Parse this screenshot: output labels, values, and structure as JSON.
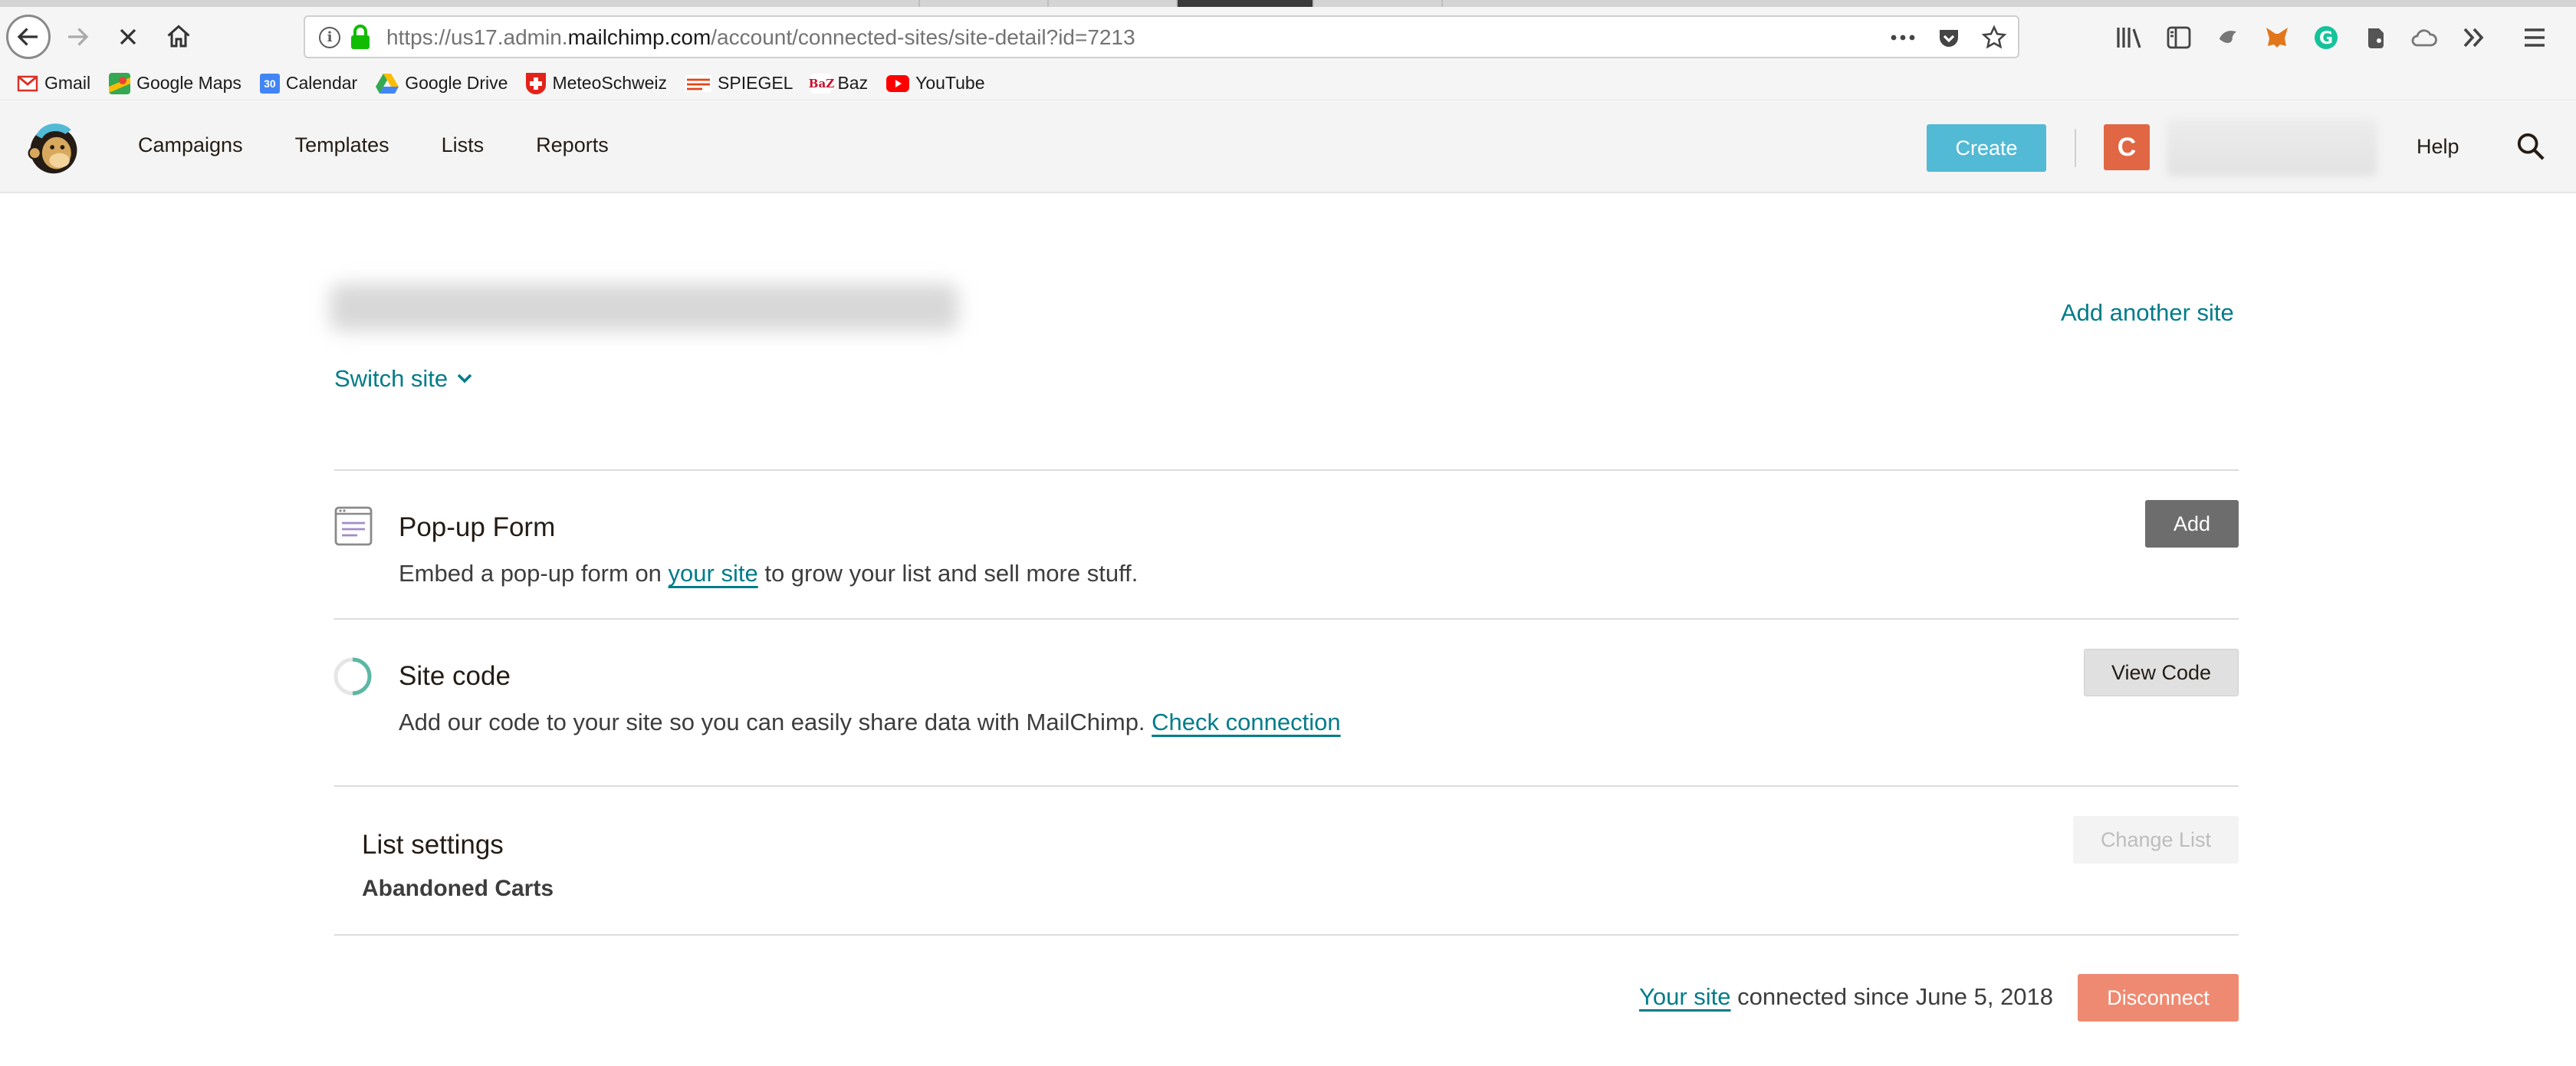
{
  "browser": {
    "url_prefix": "https://us17.admin.",
    "url_domain": "mailchimp.com",
    "url_path": "/account/connected-sites/site-detail?id=7213",
    "bookmarks": [
      {
        "label": "Gmail",
        "icon": "gmail-icon",
        "color": "#d93025"
      },
      {
        "label": "Google Maps",
        "icon": "maps-icon",
        "color": "#34a853"
      },
      {
        "label": "Calendar",
        "icon": "calendar-icon",
        "color": "#4285f4",
        "glyph": "30"
      },
      {
        "label": "Google Drive",
        "icon": "drive-icon",
        "color": "#fbbc04"
      },
      {
        "label": "MeteoSchweiz",
        "icon": "swiss-flag-icon",
        "color": "#e2231a"
      },
      {
        "label": "SPIEGEL",
        "icon": "spiegel-icon",
        "color": "#e64415"
      },
      {
        "label": "Baz",
        "icon": "baz-icon",
        "color": "#c8102e",
        "glyph": "BaZ"
      },
      {
        "label": "YouTube",
        "icon": "youtube-icon",
        "color": "#ff0000"
      }
    ]
  },
  "header": {
    "nav": [
      "Campaigns",
      "Templates",
      "Lists",
      "Reports"
    ],
    "create_label": "Create",
    "avatar_initial": "C",
    "help_label": "Help"
  },
  "site": {
    "add_another_label": "Add another site",
    "switch_label": "Switch site"
  },
  "popup_form": {
    "title": "Pop-up Form",
    "desc_before": "Embed a pop-up form on ",
    "desc_link": "your site",
    "desc_after": " to grow your list and sell more stuff.",
    "button": "Add"
  },
  "site_code": {
    "title": "Site code",
    "desc_before": "Add our code to your site so you can easily share data with MailChimp. ",
    "desc_link": "Check connection",
    "button": "View Code"
  },
  "list_settings": {
    "title": "List settings",
    "list_name": "Abandoned Carts",
    "button": "Change List"
  },
  "footer": {
    "link": "Your site",
    "text": " connected since June 5, 2018",
    "button": "Disconnect"
  },
  "colors": {
    "link": "#007c89",
    "create": "#52bad5",
    "disconnect": "#ef8a72",
    "avatar": "#e06644"
  }
}
